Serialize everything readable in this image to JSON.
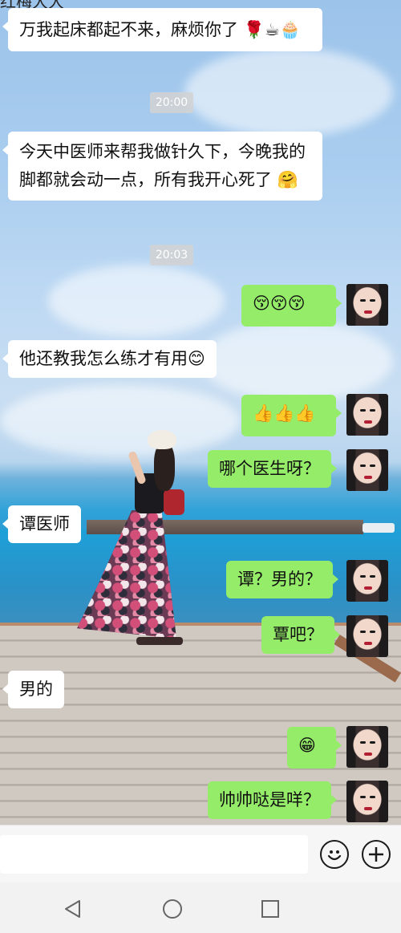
{
  "header": {
    "title_partial": "红梅大大"
  },
  "chat": {
    "messages": [
      {
        "id": "m1",
        "side": "in",
        "text": "万我起床都起不来，麻烦你了",
        "emoji": "🌹☕🧁"
      },
      {
        "id": "t1",
        "type": "time",
        "text": "20:00"
      },
      {
        "id": "m2",
        "side": "in",
        "text": "今天中医师来帮我做针久下，今晚我的脚都就会动一点，所有我开心死了",
        "emoji": "🤗"
      },
      {
        "id": "t2",
        "type": "time",
        "text": "20:03"
      },
      {
        "id": "m3",
        "side": "out",
        "text": "",
        "emoji": "😚😚😚"
      },
      {
        "id": "m4",
        "side": "in",
        "text": "他还教我怎么练才有用",
        "emoji": "😊"
      },
      {
        "id": "m5",
        "side": "out",
        "text": "",
        "emoji": "👍👍👍"
      },
      {
        "id": "m6",
        "side": "out",
        "text": "哪个医生呀？",
        "emoji": ""
      },
      {
        "id": "m7",
        "side": "in",
        "text": "谭医师",
        "emoji": ""
      },
      {
        "id": "m8",
        "side": "out",
        "text": "谭？男的？",
        "emoji": ""
      },
      {
        "id": "m9",
        "side": "out",
        "text": "覃吧？",
        "emoji": ""
      },
      {
        "id": "m10",
        "side": "in",
        "text": "男的",
        "emoji": ""
      },
      {
        "id": "m11",
        "side": "out",
        "text": "",
        "emoji": "😁"
      },
      {
        "id": "m12",
        "side": "out",
        "text": "帅帅哒是咩？",
        "emoji": ""
      }
    ]
  },
  "input": {
    "value": "",
    "placeholder": ""
  },
  "icons": {
    "emoji_button": "emoji-smile-icon",
    "plus_button": "plus-icon",
    "nav_back": "back-triangle-icon",
    "nav_home": "home-circle-icon",
    "nav_recent": "recent-square-icon"
  },
  "colors": {
    "outgoing_bubble": "#95ec69",
    "incoming_bubble": "#ffffff",
    "input_bar": "#f6f6f6",
    "nav_bar": "#f2f2f2"
  }
}
